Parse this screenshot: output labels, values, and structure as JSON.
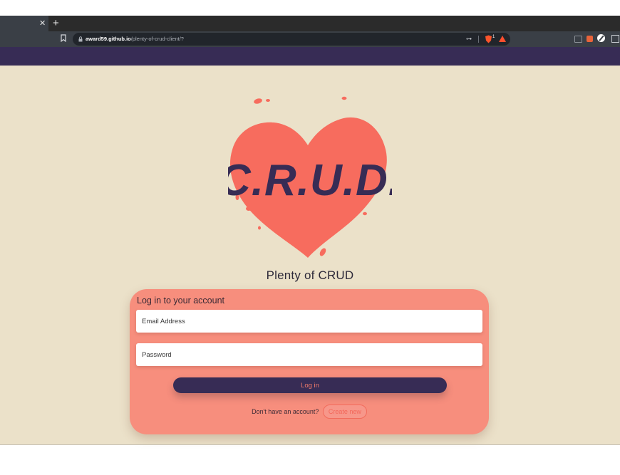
{
  "browser": {
    "url_host": "award59.github.io",
    "url_path": "/plenty-of-crud-client/?",
    "brave_badge_count": "1"
  },
  "logo": {
    "text": "C.R.U.D."
  },
  "app": {
    "title": "Plenty of CRUD"
  },
  "login": {
    "heading": "Log in to your account",
    "email_placeholder": "Email Address",
    "password_placeholder": "Password",
    "submit_label": "Log in",
    "signup_prompt": "Don't have an account?",
    "signup_link": "Create new"
  },
  "colors": {
    "navbar": "#372c55",
    "background": "#ebe1c9",
    "card": "#f78e7d",
    "heart": "#f76c5e"
  }
}
